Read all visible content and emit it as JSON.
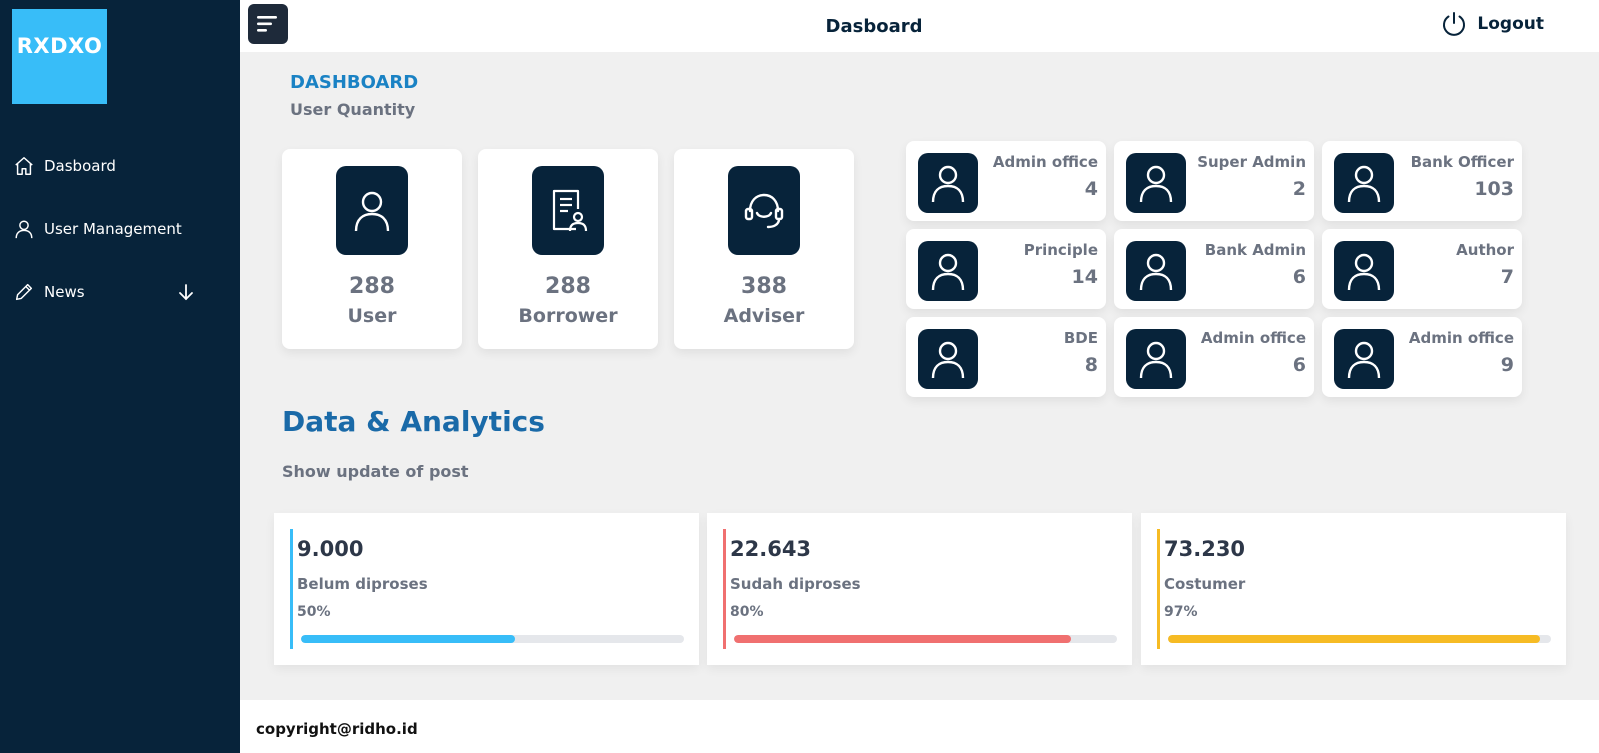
{
  "sidebar": {
    "logo": "RXDXO",
    "items": [
      {
        "label": "Dasboard",
        "icon": "home-icon"
      },
      {
        "label": "User Management",
        "icon": "user-icon"
      },
      {
        "label": "News",
        "icon": "pencil-icon",
        "expand_icon": "arrow-down-icon"
      }
    ]
  },
  "topbar": {
    "title": "Dasboard",
    "logout_label": "Logout"
  },
  "header": {
    "title": "DASHBOARD",
    "subtitle": "User Quantity"
  },
  "big_cards": [
    {
      "value": "288",
      "label": "User",
      "icon": "user-icon"
    },
    {
      "value": "288",
      "label": "Borrower",
      "icon": "document-user-icon"
    },
    {
      "value": "388",
      "label": "Adviser",
      "icon": "headset-icon"
    }
  ],
  "small_cards": [
    {
      "label": "Admin office",
      "value": "4"
    },
    {
      "label": "Super Admin",
      "value": "2"
    },
    {
      "label": "Bank Officer",
      "value": "103"
    },
    {
      "label": "Principle",
      "value": "14"
    },
    {
      "label": "Bank Admin",
      "value": "6"
    },
    {
      "label": "Author",
      "value": "7"
    },
    {
      "label": "BDE",
      "value": "8"
    },
    {
      "label": "Admin office",
      "value": "6"
    },
    {
      "label": "Admin office",
      "value": "9"
    }
  ],
  "analytics": {
    "title": "Data & Analytics",
    "subtitle": "Show update of post",
    "stats": [
      {
        "value": "9.000",
        "label": "Belum diproses",
        "percent_label": "50%",
        "fill": 0.56,
        "color": "#38bdf8"
      },
      {
        "value": "22.643",
        "label": "Sudah diproses",
        "percent_label": "80%",
        "fill": 0.88,
        "color": "#f07070"
      },
      {
        "value": "73.230",
        "label": "Costumer",
        "percent_label": "97%",
        "fill": 0.97,
        "color": "#f6bb24"
      }
    ]
  },
  "footer": {
    "text": "copyright@ridho.id"
  }
}
